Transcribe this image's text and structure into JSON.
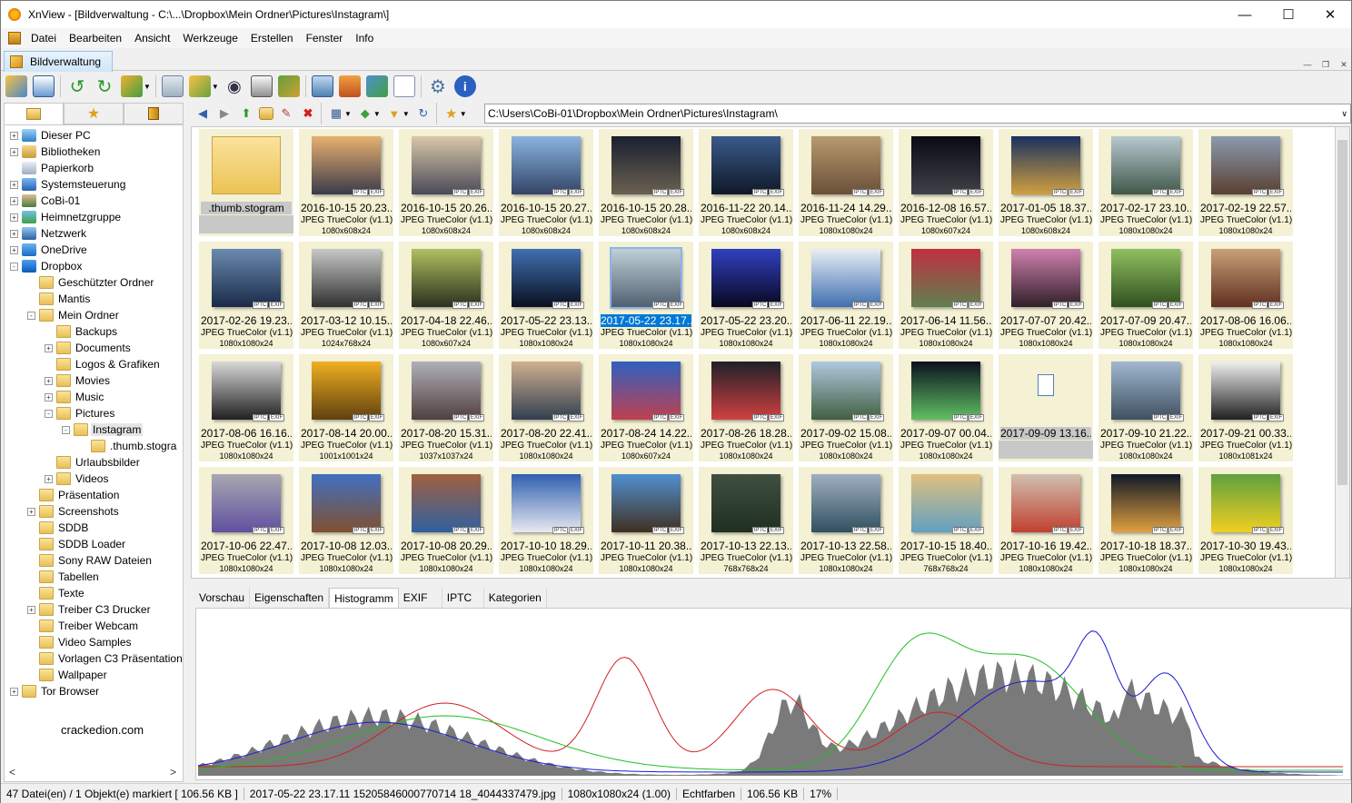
{
  "window": {
    "title": "XnView - [Bildverwaltung - C:\\...\\Dropbox\\Mein Ordner\\Pictures\\Instagram\\]"
  },
  "menu": [
    "Datei",
    "Bearbeiten",
    "Ansicht",
    "Werkzeuge",
    "Erstellen",
    "Fenster",
    "Info"
  ],
  "doc_tab": "Bildverwaltung",
  "address": "C:\\Users\\CoBi-01\\Dropbox\\Mein Ordner\\Pictures\\Instagram\\",
  "tree": [
    {
      "label": "Dieser PC",
      "depth": 0,
      "expander": "+",
      "icon": "computer-icon"
    },
    {
      "label": "Bibliotheken",
      "depth": 0,
      "expander": "+",
      "icon": "library-icon"
    },
    {
      "label": "Papierkorb",
      "depth": 0,
      "expander": "",
      "icon": "recycle-bin-icon"
    },
    {
      "label": "Systemsteuerung",
      "depth": 0,
      "expander": "+",
      "icon": "control-panel-icon"
    },
    {
      "label": "CoBi-01",
      "depth": 0,
      "expander": "+",
      "icon": "user-icon"
    },
    {
      "label": "Heimnetzgruppe",
      "depth": 0,
      "expander": "+",
      "icon": "homegroup-icon"
    },
    {
      "label": "Netzwerk",
      "depth": 0,
      "expander": "+",
      "icon": "network-icon"
    },
    {
      "label": "OneDrive",
      "depth": 0,
      "expander": "+",
      "icon": "cloud-icon"
    },
    {
      "label": "Dropbox",
      "depth": 0,
      "expander": "-",
      "icon": "dropbox-icon"
    },
    {
      "label": "Geschützter Ordner",
      "depth": 1,
      "expander": "",
      "icon": "folder-icon"
    },
    {
      "label": "Mantis",
      "depth": 1,
      "expander": "",
      "icon": "folder-icon"
    },
    {
      "label": "Mein Ordner",
      "depth": 1,
      "expander": "-",
      "icon": "folder-icon"
    },
    {
      "label": "Backups",
      "depth": 2,
      "expander": "",
      "icon": "folder-icon"
    },
    {
      "label": "Documents",
      "depth": 2,
      "expander": "+",
      "icon": "folder-icon"
    },
    {
      "label": "Logos & Grafiken",
      "depth": 2,
      "expander": "",
      "icon": "folder-icon"
    },
    {
      "label": "Movies",
      "depth": 2,
      "expander": "+",
      "icon": "folder-icon"
    },
    {
      "label": "Music",
      "depth": 2,
      "expander": "+",
      "icon": "folder-icon"
    },
    {
      "label": "Pictures",
      "depth": 2,
      "expander": "-",
      "icon": "folder-icon"
    },
    {
      "label": "Instagram",
      "depth": 3,
      "expander": "-",
      "icon": "folder-icon",
      "selected": true
    },
    {
      "label": ".thumb.stogra",
      "depth": 4,
      "expander": "",
      "icon": "folder-icon"
    },
    {
      "label": "Urlaubsbilder",
      "depth": 2,
      "expander": "",
      "icon": "folder-icon"
    },
    {
      "label": "Videos",
      "depth": 2,
      "expander": "+",
      "icon": "folder-icon"
    },
    {
      "label": "Präsentation",
      "depth": 1,
      "expander": "",
      "icon": "folder-icon"
    },
    {
      "label": "Screenshots",
      "depth": 1,
      "expander": "+",
      "icon": "folder-icon"
    },
    {
      "label": "SDDB",
      "depth": 1,
      "expander": "",
      "icon": "folder-icon"
    },
    {
      "label": "SDDB Loader",
      "depth": 1,
      "expander": "",
      "icon": "folder-icon"
    },
    {
      "label": "Sony RAW Dateien",
      "depth": 1,
      "expander": "",
      "icon": "folder-icon"
    },
    {
      "label": "Tabellen",
      "depth": 1,
      "expander": "",
      "icon": "folder-icon"
    },
    {
      "label": "Texte",
      "depth": 1,
      "expander": "",
      "icon": "folder-icon"
    },
    {
      "label": "Treiber C3 Drucker",
      "depth": 1,
      "expander": "+",
      "icon": "folder-icon"
    },
    {
      "label": "Treiber Webcam",
      "depth": 1,
      "expander": "",
      "icon": "folder-icon"
    },
    {
      "label": "Video Samples",
      "depth": 1,
      "expander": "",
      "icon": "folder-icon"
    },
    {
      "label": "Vorlagen C3 Präsentation",
      "depth": 1,
      "expander": "",
      "icon": "folder-icon"
    },
    {
      "label": "Wallpaper",
      "depth": 1,
      "expander": "",
      "icon": "folder-icon"
    },
    {
      "label": "Tor Browser",
      "depth": 0,
      "expander": "+",
      "icon": "folder-icon"
    }
  ],
  "watermark": "crackedion.com",
  "thumb_type": "JPEG TrueColor (v1.1)",
  "badges": {
    "iptc": "IPTC",
    "exif": "EXIF"
  },
  "folder_tile": {
    "name": ".thumb.stogram"
  },
  "thumbs": [
    {
      "name": "2016-10-15 20.23...",
      "dims": "1080x608x24",
      "colors": [
        "#e8b070",
        "#3a3a4a"
      ]
    },
    {
      "name": "2016-10-15 20.26...",
      "dims": "1080x608x24",
      "colors": [
        "#d8c8a8",
        "#4a4a58"
      ]
    },
    {
      "name": "2016-10-15 20.27...",
      "dims": "1080x608x24",
      "colors": [
        "#8ab4e0",
        "#334466"
      ]
    },
    {
      "name": "2016-10-15 20.28...",
      "dims": "1080x608x24",
      "colors": [
        "#1a2030",
        "#6a6050"
      ]
    },
    {
      "name": "2016-11-22 20.14...",
      "dims": "1080x608x24",
      "colors": [
        "#3a5a8a",
        "#101828"
      ]
    },
    {
      "name": "2016-11-24 14.29...",
      "dims": "1080x1080x24",
      "colors": [
        "#b89a70",
        "#6a5038"
      ]
    },
    {
      "name": "2016-12-08 16.57...",
      "dims": "1080x607x24",
      "colors": [
        "#0a0a12",
        "#404048"
      ]
    },
    {
      "name": "2017-01-05 18.37...",
      "dims": "1080x608x24",
      "colors": [
        "#1a3060",
        "#d0a040"
      ]
    },
    {
      "name": "2017-02-17 23.10...",
      "dims": "1080x1080x24",
      "colors": [
        "#b8c8d0",
        "#405848"
      ]
    },
    {
      "name": "2017-02-19 22.57...",
      "dims": "1080x1080x24",
      "colors": [
        "#8a9ab0",
        "#5a4030"
      ]
    },
    {
      "name": "2017-02-26 19.23...",
      "dims": "1080x1080x24",
      "colors": [
        "#6a8ab0",
        "#1a2a48"
      ]
    },
    {
      "name": "2017-03-12 10.15...",
      "dims": "1024x768x24",
      "colors": [
        "#c8c8c8",
        "#303030"
      ]
    },
    {
      "name": "2017-04-18 22.46...",
      "dims": "1080x607x24",
      "colors": [
        "#b0c060",
        "#2a3020"
      ]
    },
    {
      "name": "2017-05-22 23.13...",
      "dims": "1080x1080x24",
      "colors": [
        "#4070b0",
        "#0a1020"
      ]
    },
    {
      "name": "2017-05-22 23.17...",
      "dims": "1080x1080x24",
      "colors": [
        "#c0d0d8",
        "#506070"
      ],
      "selected": true
    },
    {
      "name": "2017-05-22 23.20...",
      "dims": "1080x1080x24",
      "colors": [
        "#3040c0",
        "#080820"
      ]
    },
    {
      "name": "2017-06-11 22.19...",
      "dims": "1080x1080x24",
      "colors": [
        "#e8eef4",
        "#4070b0"
      ]
    },
    {
      "name": "2017-06-14 11.56...",
      "dims": "1080x1080x24",
      "colors": [
        "#c03040",
        "#608050"
      ]
    },
    {
      "name": "2017-07-07 20.42...",
      "dims": "1080x1080x24",
      "colors": [
        "#d080b0",
        "#302028"
      ]
    },
    {
      "name": "2017-07-09 20.47...",
      "dims": "1080x1080x24",
      "colors": [
        "#90c060",
        "#305020"
      ]
    },
    {
      "name": "2017-08-06 16.06...",
      "dims": "1080x1080x24",
      "colors": [
        "#c8a078",
        "#603020"
      ]
    },
    {
      "name": "2017-08-06 16.16...",
      "dims": "1080x1080x24",
      "colors": [
        "#d8d8d8",
        "#202020"
      ]
    },
    {
      "name": "2017-08-14 20.00...",
      "dims": "1001x1001x24",
      "colors": [
        "#f0b020",
        "#604010"
      ]
    },
    {
      "name": "2017-08-20 15.31...",
      "dims": "1037x1037x24",
      "colors": [
        "#b0b0b8",
        "#504040"
      ]
    },
    {
      "name": "2017-08-20 22.41...",
      "dims": "1080x1080x24",
      "colors": [
        "#d0b090",
        "#304050"
      ]
    },
    {
      "name": "2017-08-24 14.22...",
      "dims": "1080x607x24",
      "colors": [
        "#3060c0",
        "#c04050"
      ]
    },
    {
      "name": "2017-08-26 18.28...",
      "dims": "1080x1080x24",
      "colors": [
        "#202028",
        "#d04040"
      ]
    },
    {
      "name": "2017-09-02 15.08...",
      "dims": "1080x1080x24",
      "colors": [
        "#b0c8e0",
        "#406040"
      ]
    },
    {
      "name": "2017-09-07 00.04...",
      "dims": "1080x1080x24",
      "colors": [
        "#0a1020",
        "#60c060"
      ]
    },
    {
      "name": "2017-09-09 13.16...",
      "dims": "",
      "colors": [
        "#ffffff",
        "#ffffff"
      ],
      "placeholder": true
    },
    {
      "name": "2017-09-10 21.22...",
      "dims": "1080x1080x24",
      "colors": [
        "#a0b8d0",
        "#405060"
      ]
    },
    {
      "name": "2017-09-21 00.33...",
      "dims": "1080x1081x24",
      "colors": [
        "#f0f0f0",
        "#202020"
      ]
    },
    {
      "name": "2017-10-06 22.47...",
      "dims": "1080x1080x24",
      "colors": [
        "#a8a8b0",
        "#6050a0"
      ]
    },
    {
      "name": "2017-10-08 12.03...",
      "dims": "1080x1080x24",
      "colors": [
        "#4070c0",
        "#805030"
      ]
    },
    {
      "name": "2017-10-08 20.29...",
      "dims": "1080x1080x24",
      "colors": [
        "#a06040",
        "#3060a0"
      ]
    },
    {
      "name": "2017-10-10 18.29...",
      "dims": "1080x1080x24",
      "colors": [
        "#3060b0",
        "#e8e8f0"
      ]
    },
    {
      "name": "2017-10-11 20.38...",
      "dims": "1080x1080x24",
      "colors": [
        "#5090d0",
        "#403020"
      ]
    },
    {
      "name": "2017-10-13 22.13...",
      "dims": "768x768x24",
      "colors": [
        "#405040",
        "#203020"
      ]
    },
    {
      "name": "2017-10-13 22.58...",
      "dims": "1080x1080x24",
      "colors": [
        "#a0b0c0",
        "#305060"
      ]
    },
    {
      "name": "2017-10-15 18.40...",
      "dims": "768x768x24",
      "colors": [
        "#e0c080",
        "#60a0c0"
      ]
    },
    {
      "name": "2017-10-16 19.42...",
      "dims": "1080x1080x24",
      "colors": [
        "#d0c0b0",
        "#c04030"
      ]
    },
    {
      "name": "2017-10-18 18.37...",
      "dims": "1080x1080x24",
      "colors": [
        "#101828",
        "#e0a040"
      ]
    },
    {
      "name": "2017-10-30 19.43...",
      "dims": "1080x1080x24",
      "colors": [
        "#60a040",
        "#f0d020"
      ]
    }
  ],
  "bottom_tabs": [
    "Vorschau",
    "Eigenschaften",
    "Histogramm",
    "EXIF",
    "IPTC",
    "Kategorien"
  ],
  "bottom_active": "Histogramm",
  "status": [
    "47 Datei(en) / 1 Objekt(e) markiert  [ 106.56 KB ]",
    "2017-05-22 23.17.11 15205846000770714 18_4044337479.jpg",
    "1080x1080x24 (1.00)",
    "Echtfarben",
    "106.56 KB",
    "17%"
  ],
  "histogram_colors": {
    "luma": "#7a7a7a",
    "red": "#d02020",
    "green": "#20c020",
    "blue": "#1a1ad0"
  }
}
